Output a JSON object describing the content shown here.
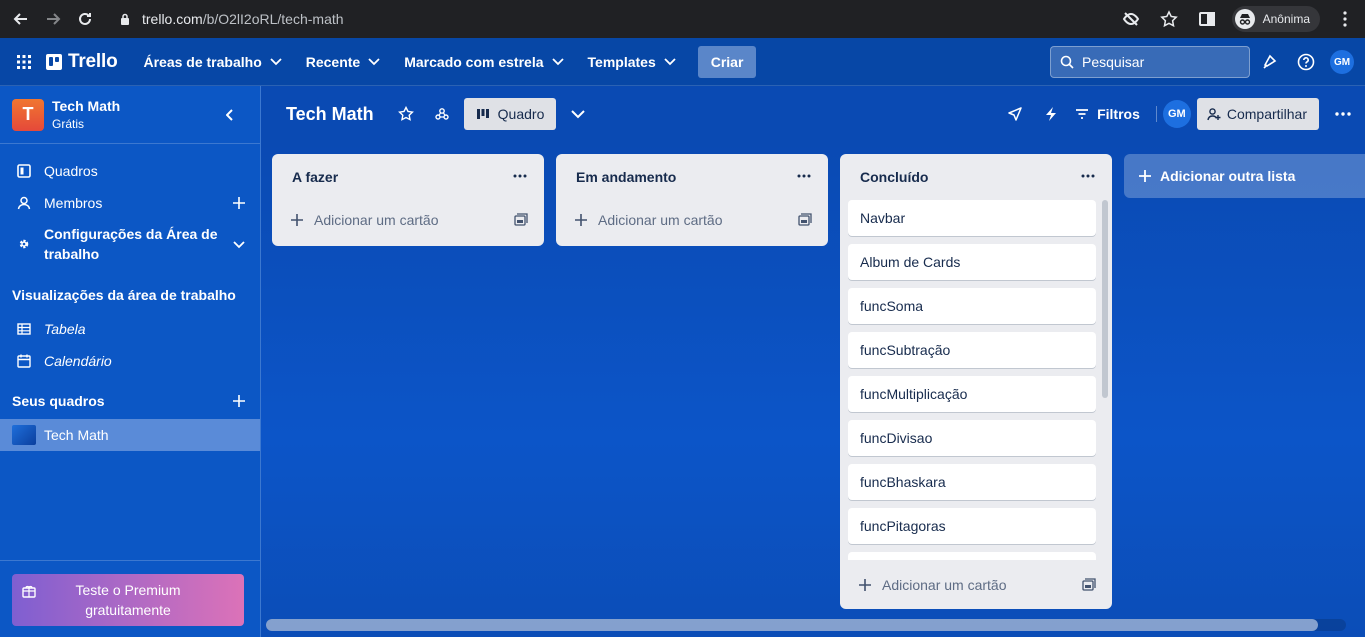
{
  "browser": {
    "url_domain": "trello.com",
    "url_path": "/b/O2lI2oRL/tech-math",
    "profile_label": "Anônima"
  },
  "header": {
    "logo": "Trello",
    "menus": [
      "Áreas de trabalho",
      "Recente",
      "Marcado com estrela",
      "Templates"
    ],
    "create": "Criar",
    "search_placeholder": "Pesquisar",
    "avatar": "GM"
  },
  "sidebar": {
    "workspace_initial": "T",
    "workspace_name": "Tech Math",
    "workspace_plan": "Grátis",
    "items": [
      {
        "label": "Quadros",
        "icon": "board-icon"
      },
      {
        "label": "Membros",
        "icon": "person-icon"
      },
      {
        "label": "Configurações da Área de trabalho",
        "icon": "gear-icon"
      }
    ],
    "views_title": "Visualizações da área de trabalho",
    "views": [
      {
        "label": "Tabela",
        "icon": "table-icon"
      },
      {
        "label": "Calendário",
        "icon": "calendar-icon"
      }
    ],
    "boards_title": "Seus quadros",
    "boards": [
      {
        "label": "Tech Math"
      }
    ],
    "premium": "Teste o Premium gratuitamente"
  },
  "board": {
    "title": "Tech Math",
    "view": "Quadro",
    "filters": "Filtros",
    "avatar": "GM",
    "share": "Compartilhar",
    "add_list": "Adicionar outra lista",
    "lists": [
      {
        "title": "A fazer",
        "cards": [],
        "add_card": "Adicionar um cartão"
      },
      {
        "title": "Em andamento",
        "cards": [],
        "add_card": "Adicionar um cartão"
      },
      {
        "title": "Concluído",
        "cards": [
          "Navbar",
          "Album de Cards",
          "funcSoma",
          "funcSubtração",
          "funcMultiplicação",
          "funcDivisao",
          "funcBhaskara",
          "funcPitagoras"
        ],
        "add_card": "Adicionar um cartão"
      }
    ]
  },
  "colors": {
    "header_bg": "#0747a6",
    "sidebar_bg": "#0c57c5",
    "board_bg": "#0a4ab3",
    "list_bg": "#ebecf0",
    "workspace_logo": "#e5493a"
  }
}
